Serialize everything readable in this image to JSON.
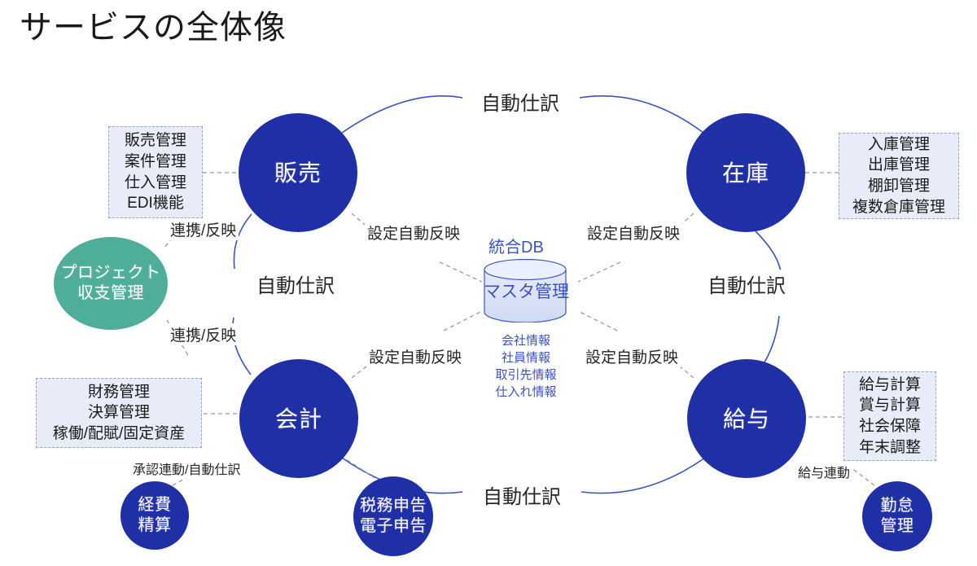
{
  "title": "サービスの全体像",
  "theme": {
    "circle_blue": "#1F2FA6",
    "circle_green": "#4FAE99",
    "box_fill": "#E8ECF8",
    "box_border": "#9AA3BB",
    "db_text": "#3A53C0",
    "arc_stroke": "#3A53C0",
    "dash_stroke": "#9A9A9A",
    "background": "#FFFFFF"
  },
  "nodes": {
    "sales": {
      "label": "販売"
    },
    "inventory": {
      "label": "在庫"
    },
    "accounting": {
      "label": "会計"
    },
    "payroll": {
      "label": "給与"
    },
    "project": {
      "label": "プロジェクト\n収支管理"
    },
    "expense": {
      "label": "経費\n精算"
    },
    "tax": {
      "label": "税務申告\n電子申告"
    },
    "attendance": {
      "label": "勤怠\n管理"
    }
  },
  "feature_boxes": {
    "sales_features": {
      "label": "販売管理\n案件管理\n仕入管理\nEDI機能"
    },
    "inventory_features": {
      "label": "入庫管理\n出庫管理\n棚卸管理\n複数倉庫管理"
    },
    "accounting_features": {
      "label": "財務管理\n決算管理\n稼働/配賦/固定資産"
    },
    "payroll_features": {
      "label": "給与計算\n賞与計算\n社会保障\n年末調整"
    }
  },
  "database": {
    "title": "統合DB",
    "cylinder_label": "マスタ管理",
    "items": "会社情報\n社員情報\n取引先情報\n仕入れ情報"
  },
  "edge_labels": {
    "top_auto_journal": "自動仕訳",
    "left_auto_journal": "自動仕訳",
    "right_auto_journal": "自動仕訳",
    "bottom_auto_journal": "自動仕訳",
    "sales_db": "設定自動反映",
    "inventory_db": "設定自動反映",
    "accounting_db": "設定自動反映",
    "payroll_db": "設定自動反映",
    "project_sales": "連携/反映",
    "project_accounting": "連携/反映",
    "expense_accounting": "承認連動/自動仕訳",
    "attendance_payroll": "給与連動"
  }
}
